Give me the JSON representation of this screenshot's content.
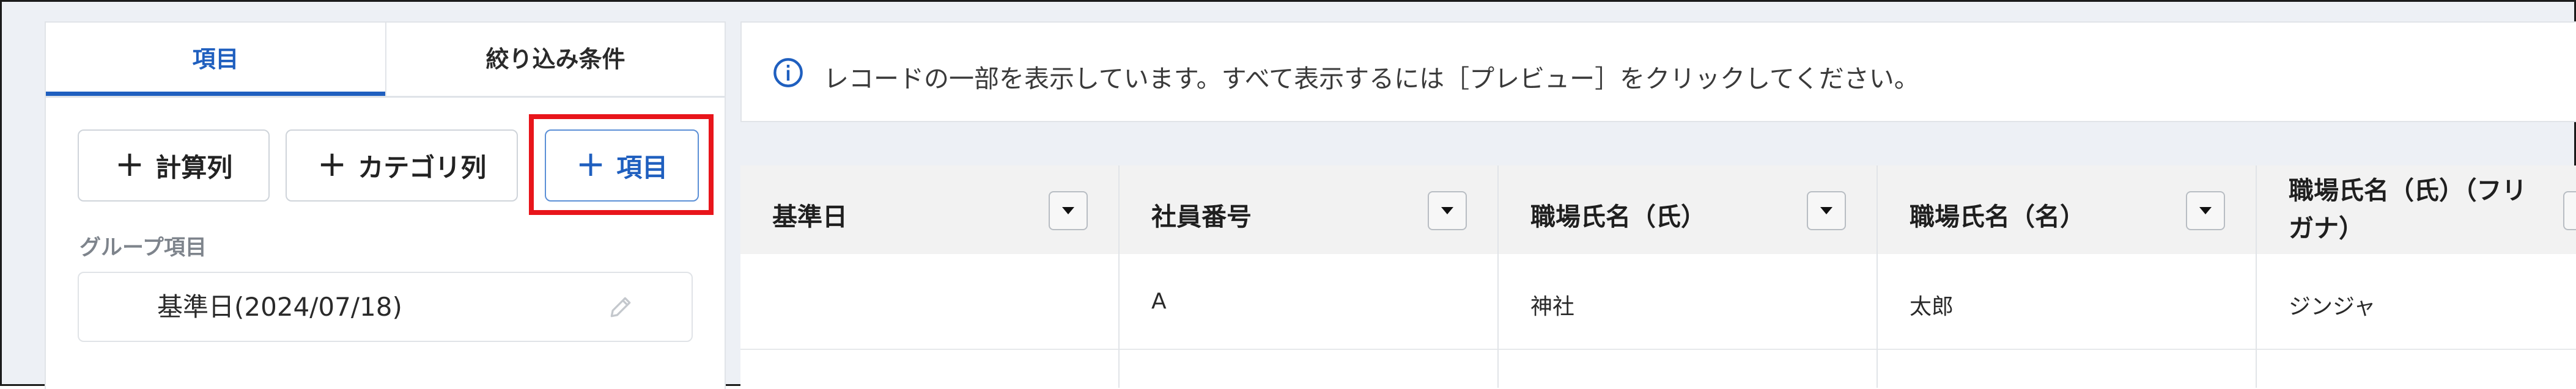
{
  "left_panel": {
    "tabs": [
      {
        "label": "項目",
        "active": true
      },
      {
        "label": "絞り込み条件",
        "active": false
      }
    ],
    "buttons": {
      "calc_label": "計算列",
      "category_label": "カテゴリ列",
      "item_label": "項目"
    },
    "group_label": "グループ項目",
    "group_field_value": "基準日(2024/07/18)"
  },
  "info": {
    "message": "レコードの一部を表示しています。すべて表示するには［プレビュー］をクリックしてください。"
  },
  "table": {
    "columns": [
      {
        "title_line1": "基準日",
        "title_line2": ""
      },
      {
        "title_line1": "社員番号",
        "title_line2": ""
      },
      {
        "title_line1": "職場氏名（氏）",
        "title_line2": ""
      },
      {
        "title_line1": "職場氏名（名）",
        "title_line2": ""
      },
      {
        "title_line1": "職場氏名（氏）（フリ",
        "title_line2": "ガナ）"
      }
    ],
    "rows": [
      {
        "cells": [
          "",
          "A",
          "神社",
          "太郎",
          "ジンジャ"
        ]
      }
    ]
  },
  "colors": {
    "accent": "#1f5fbf",
    "highlight": "#e8151b",
    "background": "#edf0f5"
  },
  "icons": [
    "plus-icon",
    "pencil-icon",
    "info-icon",
    "dropdown-triangle-icon"
  ]
}
